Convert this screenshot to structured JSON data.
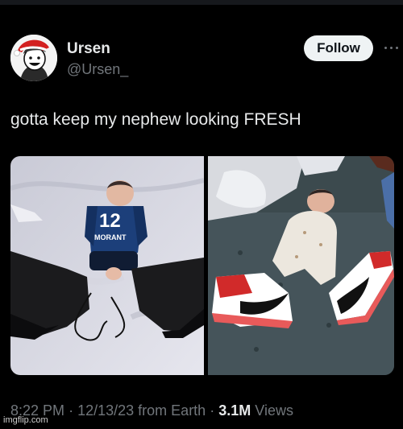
{
  "author": {
    "display_name": "Ursen",
    "handle": "@Ursen_"
  },
  "follow_label": "Follow",
  "tweet_text": "gotta keep my nephew looking FRESH",
  "media": {
    "left_photo": {
      "jersey_number": "12",
      "jersey_name": "MORANT"
    }
  },
  "meta": {
    "time": "8:22 PM",
    "date": "12/13/23",
    "source": "from Earth",
    "views_count": "3.1M",
    "views_label": "Views",
    "separator": "·"
  },
  "watermark": "imgflip.com",
  "colors": {
    "background": "#000000",
    "text": "#e7e9ea",
    "muted": "#71767b",
    "follow_bg": "#eff3f4"
  }
}
